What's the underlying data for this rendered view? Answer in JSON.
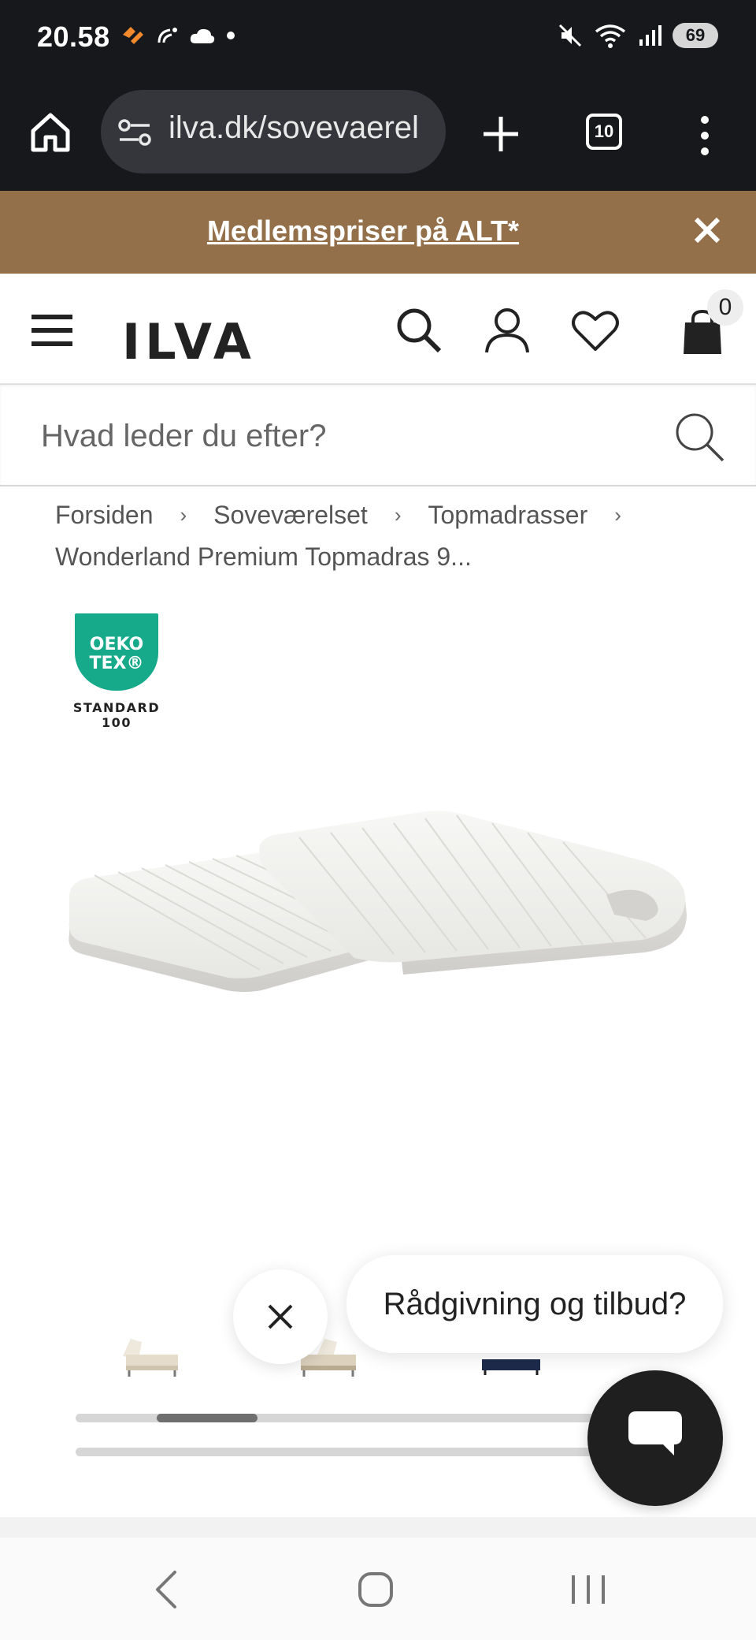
{
  "status_bar": {
    "time": "20.58",
    "battery": "69",
    "icons_left": [
      "app-notification-icon",
      "dot-notification-icon",
      "cloud-icon",
      "dot-icon"
    ],
    "icons_right": [
      "mute-icon",
      "wifi-icon",
      "signal-icon",
      "battery-icon"
    ]
  },
  "browser": {
    "url": "ilva.dk/sovevaerel",
    "tab_count": "10"
  },
  "promo": {
    "text": "Medlemspriser på ALT*"
  },
  "header": {
    "logo": "ILVA",
    "cart_count": "0"
  },
  "search": {
    "placeholder": "Hvad leder du efter?"
  },
  "breadcrumb": {
    "items": [
      "Forsiden",
      "Soveværelset",
      "Topmadrasser"
    ],
    "separator": "›",
    "current": "Wonderland Premium Topmadras 9..."
  },
  "badge": {
    "line1": "OEKO",
    "line2": "TEX®",
    "std1": "STANDARD",
    "std2": "100"
  },
  "gallery": {
    "scroll_position": 0.18
  },
  "chat": {
    "bubble_text": "Rådgivning og tilbud?"
  },
  "colors": {
    "promo_bg": "#93704a",
    "oeko_green": "#16a98a",
    "status_bg": "#17181b"
  }
}
